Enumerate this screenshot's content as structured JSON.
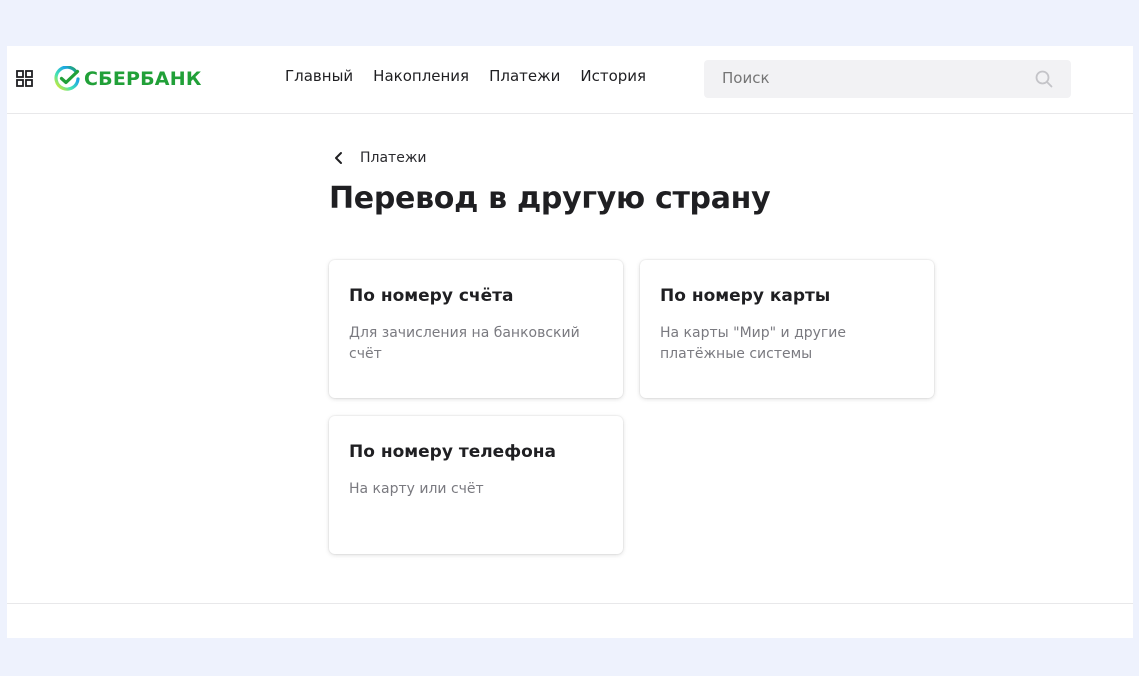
{
  "header": {
    "logo_text": "СБЕРБАНК",
    "brand_color": "#21a038",
    "apps_icon": "grid-icon",
    "nav": [
      {
        "label": "Главный"
      },
      {
        "label": "Накопления"
      },
      {
        "label": "Платежи"
      },
      {
        "label": "История"
      }
    ],
    "search": {
      "placeholder": "Поиск",
      "icon": "search-icon"
    }
  },
  "breadcrumb": {
    "icon": "chevron-left-icon",
    "label": "Платежи"
  },
  "page_title": "Перевод в другую страну",
  "cards": [
    {
      "title": "По номеру счёта",
      "description": "Для зачисления на банковский счёт"
    },
    {
      "title": "По номеру карты",
      "description": "На карты \"Мир\" и другие платёжные системы"
    },
    {
      "title": "По номеру телефона",
      "description": "На карту или счёт"
    }
  ]
}
